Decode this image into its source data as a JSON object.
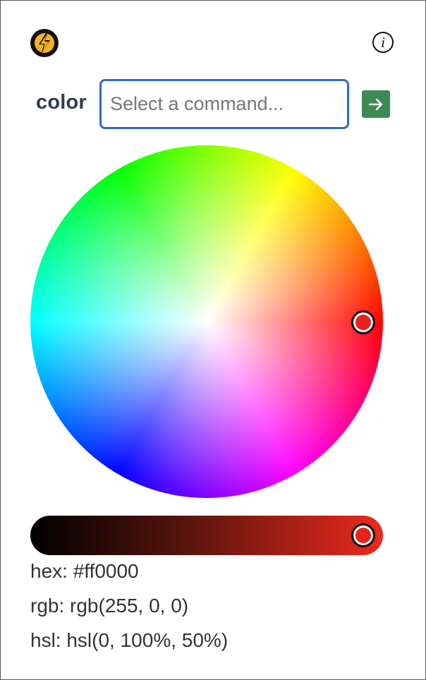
{
  "header": {
    "logo_icon": "lightning-bolt-icon",
    "info_icon": "info-icon",
    "info_glyph": "i"
  },
  "command": {
    "label": "color",
    "placeholder": "Select a command...",
    "value": "",
    "submit_icon": "arrow-right-icon"
  },
  "colors": {
    "accent_input_border": "#2f6bc3",
    "submit_button": "#3d8b53",
    "selected": "#ff0000"
  },
  "color_picker": {
    "hue": 0,
    "saturation_percent": 100,
    "brightness_percent": 100
  },
  "values": {
    "hex": "hex: #ff0000",
    "rgb": "rgb: rgb(255, 0, 0)",
    "hsl": "hsl: hsl(0, 100%, 50%)"
  }
}
